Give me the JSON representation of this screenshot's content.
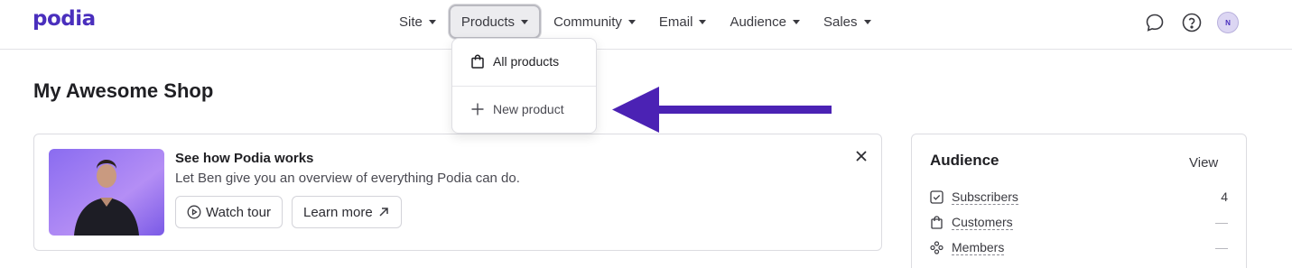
{
  "brand": {
    "logo_text": "podia",
    "accent": "#4a2fbd"
  },
  "nav": {
    "items": [
      {
        "label": "Site"
      },
      {
        "label": "Products",
        "active": true
      },
      {
        "label": "Community"
      },
      {
        "label": "Email"
      },
      {
        "label": "Audience"
      },
      {
        "label": "Sales"
      }
    ]
  },
  "header_icons": [
    "chat-icon",
    "help-icon"
  ],
  "user": {
    "initial": "N"
  },
  "products_menu": {
    "items": [
      {
        "label": "All products",
        "icon": "shopping-bag-icon"
      },
      {
        "label": "New product",
        "icon": "plus-icon"
      }
    ]
  },
  "page": {
    "title": "My Awesome Shop"
  },
  "promo": {
    "title": "See how Podia works",
    "text": "Let Ben give you an overview of everything Podia can do.",
    "watch_label": "Watch tour",
    "learn_label": "Learn more"
  },
  "audience": {
    "title": "Audience",
    "view_label": "View",
    "rows": [
      {
        "label": "Subscribers",
        "value": "4",
        "icon": "checkbox-icon"
      },
      {
        "label": "Customers",
        "value": "—",
        "icon": "shopping-bag-icon"
      },
      {
        "label": "Members",
        "value": "—",
        "icon": "members-icon"
      }
    ]
  }
}
